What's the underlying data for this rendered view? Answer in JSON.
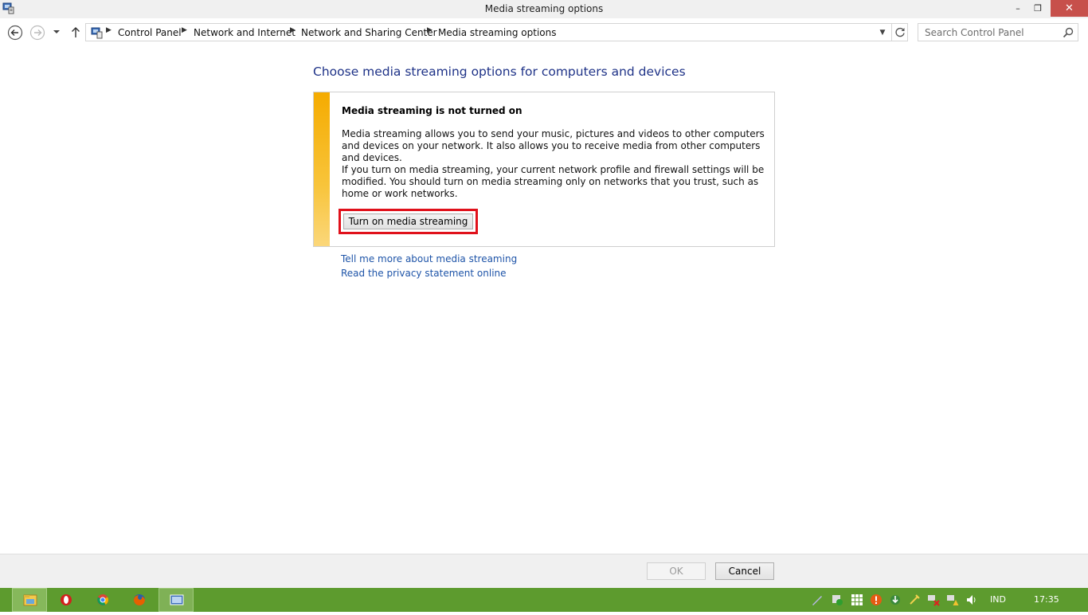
{
  "window": {
    "title": "Media streaming options",
    "minimize": "–",
    "maximize": "❐",
    "close": "✕"
  },
  "address_bar": {
    "breadcrumbs": [
      "Control Panel",
      "Network and Internet",
      "Network and Sharing Center",
      "Media streaming options"
    ],
    "separator": "▶",
    "dropdown": "▼"
  },
  "search": {
    "placeholder": "Search Control Panel"
  },
  "main": {
    "title": "Choose media streaming options for computers and devices",
    "notice": {
      "heading": "Media streaming is not turned on",
      "paragraph1": "Media streaming allows you to send your music, pictures and videos to other computers and devices on your network.  It also allows you to receive media from other computers and devices.",
      "paragraph2": "If you turn on media streaming, your current network profile and firewall settings will be modified. You should turn on media streaming only on networks that you trust, such as home or work networks.",
      "button_label": "Turn on media streaming"
    },
    "links": {
      "more": "Tell me more about media streaming",
      "privacy": "Read the privacy statement online"
    }
  },
  "dialog_buttons": {
    "ok": "OK",
    "cancel": "Cancel"
  },
  "taskbar": {
    "apps": [
      "file-explorer-icon",
      "opera-icon",
      "chrome-icon",
      "firefox-icon",
      "control-panel-icon"
    ],
    "language": "IND",
    "time": "17:35"
  },
  "colors": {
    "title_blue": "#1e3287",
    "link_blue": "#1e54a8",
    "warning_bar": "#f5ab00",
    "highlight_red": "#e0111b",
    "close_button": "#c7504b",
    "taskbar_green": "#5d9b2e"
  }
}
